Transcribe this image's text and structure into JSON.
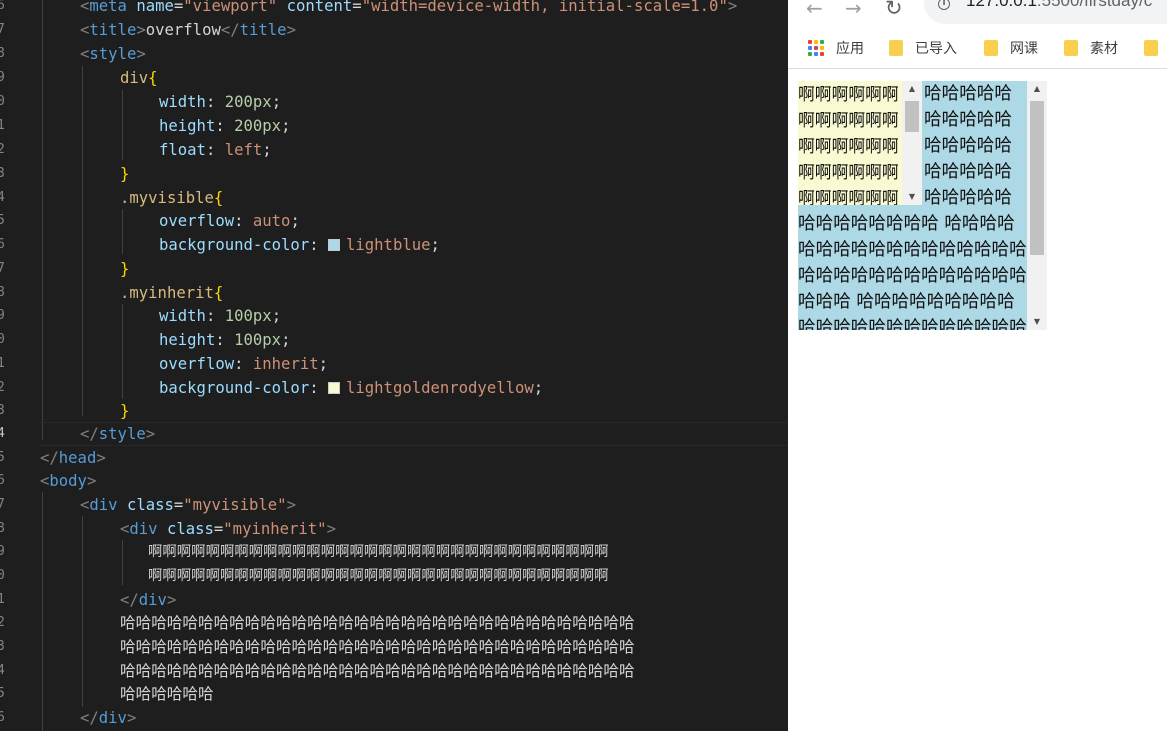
{
  "editor": {
    "line_numbers": [
      "6",
      "7",
      "8",
      "9",
      "0",
      "1",
      "2",
      "3",
      "4",
      "5",
      "6",
      "7",
      "8",
      "9",
      "0",
      "1",
      "2",
      "3",
      "4",
      "5",
      "6",
      "7",
      "8",
      "9",
      "0",
      "1",
      "2",
      "3",
      "4",
      "5",
      "6"
    ],
    "active_line_number": "4",
    "lines": {
      "l6": {
        "a": "<",
        "b": "meta",
        "c": " name",
        "d": "=",
        "e": "\"viewport\"",
        "f": " content",
        "g": "=",
        "h": "\"width=device-width, initial-scale=1.0\"",
        "i": ">"
      },
      "l7": {
        "a": "<",
        "b": "title",
        "c": ">",
        "d": "overflow",
        "e": "</",
        "f": "title",
        "g": ">"
      },
      "l8": {
        "a": "<",
        "b": "style",
        "c": ">"
      },
      "l9": {
        "a": "div",
        "b": "{"
      },
      "l10": {
        "a": "width",
        "b": ": ",
        "c": "200px",
        "d": ";"
      },
      "l11": {
        "a": "height",
        "b": ": ",
        "c": "200px",
        "d": ";"
      },
      "l12": {
        "a": "float",
        "b": ": ",
        "c": "left",
        "d": ";"
      },
      "l13": {
        "a": "}"
      },
      "l14": {
        "a": ".myvisible",
        "b": "{"
      },
      "l15": {
        "a": "overflow",
        "b": ": ",
        "c": "auto",
        "d": ";"
      },
      "l16": {
        "a": "background-color",
        "b": ": ",
        "c": "lightblue",
        "d": ";"
      },
      "l17": {
        "a": "}"
      },
      "l18": {
        "a": ".myinherit",
        "b": "{"
      },
      "l19": {
        "a": "width",
        "b": ": ",
        "c": "100px",
        "d": ";"
      },
      "l20": {
        "a": "height",
        "b": ": ",
        "c": "100px",
        "d": ";"
      },
      "l21": {
        "a": "overflow",
        "b": ": ",
        "c": "inherit",
        "d": ";"
      },
      "l22": {
        "a": "background-color",
        "b": ": ",
        "c": "lightgoldenrodyellow",
        "d": ";"
      },
      "l23": {
        "a": "}"
      },
      "l24": {
        "a": "</",
        "b": "style",
        "c": ">"
      },
      "l25": {
        "a": "</",
        "b": "head",
        "c": ">"
      },
      "l26": {
        "a": "<",
        "b": "body",
        "c": ">"
      },
      "l27": {
        "a": "<",
        "b": "div",
        "c": " class",
        "d": "=",
        "e": "\"myvisible\"",
        "f": ">"
      },
      "l28": {
        "a": "<",
        "b": "div",
        "c": " class",
        "d": "=",
        "e": "\"myinherit\"",
        "f": ">"
      },
      "l29": {
        "a": "啊啊啊啊啊啊啊啊啊啊啊啊啊啊啊啊啊啊啊啊啊啊啊啊啊啊啊啊啊啊啊啊"
      },
      "l30": {
        "a": "啊啊啊啊啊啊啊啊啊啊啊啊啊啊啊啊啊啊啊啊啊啊啊啊啊啊啊啊啊啊啊啊"
      },
      "l31": {
        "a": "</",
        "b": "div",
        "c": ">"
      },
      "l32": {
        "a": "哈哈哈哈哈哈哈哈哈哈哈哈哈哈哈哈哈哈哈哈哈哈哈哈哈哈哈哈哈哈哈哈哈"
      },
      "l33": {
        "a": "哈哈哈哈哈哈哈哈哈哈哈哈哈哈哈哈哈哈哈哈哈哈哈哈哈哈哈哈哈哈哈哈哈"
      },
      "l34": {
        "a": "哈哈哈哈哈哈哈哈哈哈哈哈哈哈哈哈哈哈哈哈哈哈哈哈哈哈哈哈哈哈哈哈哈"
      },
      "l35": {
        "a": "哈哈哈哈哈哈"
      },
      "l36": {
        "a": "</",
        "b": "div",
        "c": ">"
      }
    },
    "colors": {
      "lightblue": "#add8e6",
      "lightgoldenrodyellow": "#fafad2"
    }
  },
  "browser": {
    "back_icon": "arrow-left-icon",
    "forward_icon": "arrow-right-icon",
    "reload_icon": "reload-icon",
    "url_host": "127.0.0.1",
    "url_rest": ":5500/firstday/c",
    "bookmarks": {
      "apps": "应用",
      "imported": "已导入",
      "wangke": "网课",
      "sucai": "素材"
    },
    "page": {
      "inner_text": "啊啊啊啊啊啊啊啊啊啊啊啊啊啊啊啊啊啊啊啊啊啊啊啊啊啊啊啊啊啊啊啊啊啊啊啊啊啊啊啊啊啊啊啊啊啊啊啊啊啊啊啊啊啊啊啊啊啊啊啊啊啊啊啊",
      "outer_text": "哈哈哈哈哈哈哈哈哈哈哈哈哈哈哈哈哈哈哈哈哈哈哈哈哈哈哈哈哈哈哈哈哈 哈哈哈哈哈哈哈哈哈哈哈哈哈哈哈哈哈哈哈哈哈哈哈哈哈哈哈哈哈哈哈哈哈 哈哈哈哈哈哈哈哈哈哈哈哈哈哈哈哈哈哈哈哈哈哈哈哈哈哈哈哈哈哈哈哈哈 哈哈哈哈哈哈"
    }
  }
}
